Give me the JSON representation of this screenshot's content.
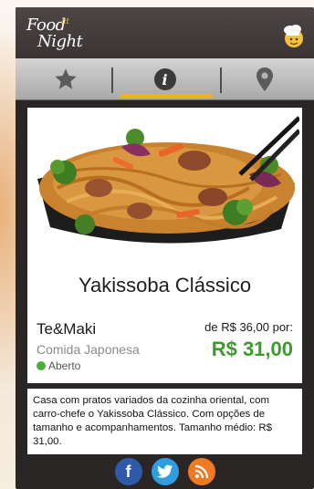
{
  "app": {
    "logo_line1": "Food",
    "logo_at": "at",
    "logo_line2": "Night"
  },
  "tabs": [
    {
      "name": "favorites",
      "icon": "star-icon",
      "active": false
    },
    {
      "name": "info",
      "icon": "info-icon",
      "glyph": "i",
      "active": true
    },
    {
      "name": "location",
      "icon": "map-pin-icon",
      "active": false
    }
  ],
  "product": {
    "name": "Yakissoba Clássico",
    "restaurant": "Te&Maki",
    "cuisine": "Comida Japonesa",
    "status": "Aberto",
    "old_price": "de R$ 36,00 por:",
    "new_price": "R$ 31,00"
  },
  "description": "Casa com pratos variados da cozinha oriental, com carro-chefe o Yakissoba Clássico. Com opções de tamanho e acompanhamentos. Tamanho médio: R$ 31,00.",
  "social": [
    {
      "name": "facebook",
      "icon": "facebook-icon",
      "color": "#2f5aa8"
    },
    {
      "name": "twitter",
      "icon": "twitter-icon",
      "color": "#2f9ee0"
    },
    {
      "name": "rss",
      "icon": "rss-icon",
      "color": "#f07a22"
    }
  ],
  "colors": {
    "accent": "#f0b419",
    "price_green": "#3d9a2c",
    "status_open": "#4caf3a",
    "topbar": "#3a3434"
  }
}
